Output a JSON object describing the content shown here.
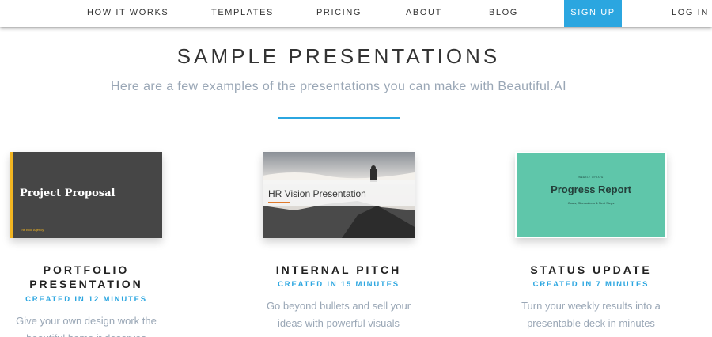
{
  "nav": {
    "how_it_works": "HOW IT WORKS",
    "templates": "TEMPLATES",
    "pricing": "PRICING",
    "about": "ABOUT",
    "blog": "BLOG",
    "sign_up": "SIGN UP",
    "log_in": "LOG IN"
  },
  "hero": {
    "title": "SAMPLE PRESENTATIONS",
    "subtitle": "Here are a few examples of the presentations you can make with Beautiful.AI"
  },
  "cards": [
    {
      "thumb": {
        "title": "Project Proposal",
        "footer": "The Bold Agency"
      },
      "title": "PORTFOLIO PRESENTATION",
      "meta": "CREATED IN 12 MINUTES",
      "desc": "Give your own design work the beautiful home it deserves"
    },
    {
      "thumb": {
        "title": "HR Vision Presentation"
      },
      "title": "INTERNAL PITCH",
      "meta": "CREATED IN 15 MINUTES",
      "desc": "Go beyond bullets and sell your ideas with powerful visuals"
    },
    {
      "thumb": {
        "kicker": "WEEKLY UPDATE",
        "title": "Progress Report",
        "subtitle": "Goals, Obervations & Next Steps"
      },
      "title": "STATUS UPDATE",
      "meta": "CREATED IN 7 MINUTES",
      "desc": "Turn your weekly results into a presentable deck in minutes"
    }
  ],
  "colors": {
    "accent": "#2ba6e0",
    "muted_text": "#9aa7b6",
    "dark_slide": "#464646",
    "gold": "#f2b521",
    "teal_slide": "#5fc6aa"
  }
}
